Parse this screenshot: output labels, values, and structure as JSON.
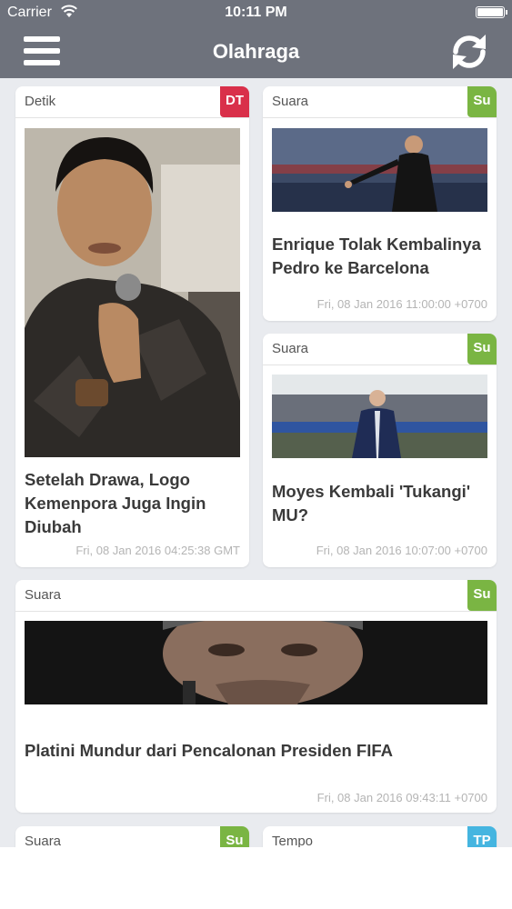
{
  "status_bar": {
    "carrier": "Carrier",
    "time": "10:11 PM"
  },
  "nav": {
    "title": "Olahraga",
    "menu_icon": "hamburger-menu-icon",
    "refresh_icon": "refresh-icon"
  },
  "colors": {
    "bar": "#6e727c",
    "background": "#e9ebef",
    "badge_detik": "#d9304a",
    "badge_suara": "#7ab543",
    "badge_tempo": "#45b5e0"
  },
  "cards": [
    {
      "source": "Detik",
      "badge": "DT",
      "headline": "Setelah Drawa, Logo Kemenpora Juga Ingin Diubah",
      "date": "Fri, 08 Jan 2016 04:25:38 GMT"
    },
    {
      "source": "Suara",
      "badge": "Su",
      "headline": "Enrique Tolak Kembalinya Pedro ke Barcelona",
      "date": "Fri, 08 Jan 2016 11:00:00 +0700"
    },
    {
      "source": "Suara",
      "badge": "Su",
      "headline": "Moyes Kembali 'Tukangi' MU?",
      "date": "Fri, 08 Jan 2016 10:07:00 +0700"
    },
    {
      "source": "Suara",
      "badge": "Su",
      "headline": "Platini Mundur dari Pencalonan Presiden FIFA",
      "date": "Fri, 08 Jan 2016 09:43:11 +0700"
    },
    {
      "source": "Suara",
      "badge": "Su"
    },
    {
      "source": "Tempo",
      "badge": "TP"
    }
  ]
}
